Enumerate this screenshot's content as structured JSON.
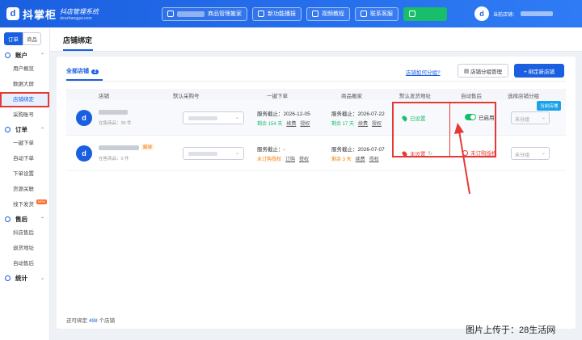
{
  "header": {
    "logo_letter": "d",
    "brand": "抖掌柜",
    "sub1": "抖店管理系统",
    "sub2": "douzhanggui.com",
    "buttons": [
      {
        "label": "商品管理搬家",
        "icon": "shop-icon"
      },
      {
        "label": "新功能播报",
        "icon": "broadcast-icon"
      },
      {
        "label": "视频教程",
        "icon": "video-icon"
      },
      {
        "label": "联系客服",
        "icon": "headset-icon"
      },
      {
        "label": "下载APP",
        "icon": "download-icon"
      }
    ],
    "user_label": "当前店铺："
  },
  "sidebar": {
    "toggle": [
      "订单",
      "商品"
    ],
    "groups": [
      {
        "title": "账户",
        "items": [
          "用户概览",
          "数据大屏",
          "店铺绑定",
          "采购账号"
        ]
      },
      {
        "title": "订单",
        "items": [
          "一键下单",
          "自动下单",
          "下单设置",
          "货源关联",
          "线下发货"
        ]
      },
      {
        "title": "售后",
        "items": [
          "抖店售后",
          "退货地址",
          "自动售后"
        ]
      },
      {
        "title": "统计",
        "items": []
      }
    ],
    "new_badge": "NEW"
  },
  "page": {
    "title": "店铺绑定"
  },
  "card": {
    "tab_label": "全部店铺",
    "tab_count": "2",
    "help_link": "店铺如何分组?",
    "group_button": "店铺分组管理",
    "bind_button": "+ 绑定新店铺",
    "columns": [
      "店铺",
      "默认采购号",
      "一键下单",
      "商品搬家",
      "默认发货地址",
      "自动售后",
      "选择店铺分组"
    ],
    "rows": [
      {
        "goods": "在售商品：39 件",
        "order_expire": "服务截止：2026-12-05",
        "order_remain": "剩余 154 天",
        "move_expire": "服务截止：2026-07-22",
        "move_remain": "剩余 17 天",
        "link_renew": "续费",
        "link_auth": "授权",
        "address": "已设置",
        "after_sale": "已启用",
        "group": "未分组",
        "current_badge": "当前店铺"
      },
      {
        "tag": "解绑",
        "goods": "在售商品：0 件",
        "order_expire": "服务截止：-",
        "order_remain": "未订购授权",
        "link_order": "订购",
        "link_auth": "授权",
        "move_expire": "服务截止：2026-07-07",
        "move_remain": "剩余 3 天",
        "link_renew": "续费",
        "address": "未设置",
        "after_sale": "未订购授权",
        "group": "未分组"
      }
    ],
    "footer_prefix": "还可绑定",
    "footer_count": "498",
    "footer_suffix": "个店铺"
  },
  "watermark": "图片上传于：28生活网",
  "colors": {
    "brand": "#1a5fe0",
    "green": "#19be6b",
    "red": "#e53935",
    "orange": "#f57c00"
  }
}
